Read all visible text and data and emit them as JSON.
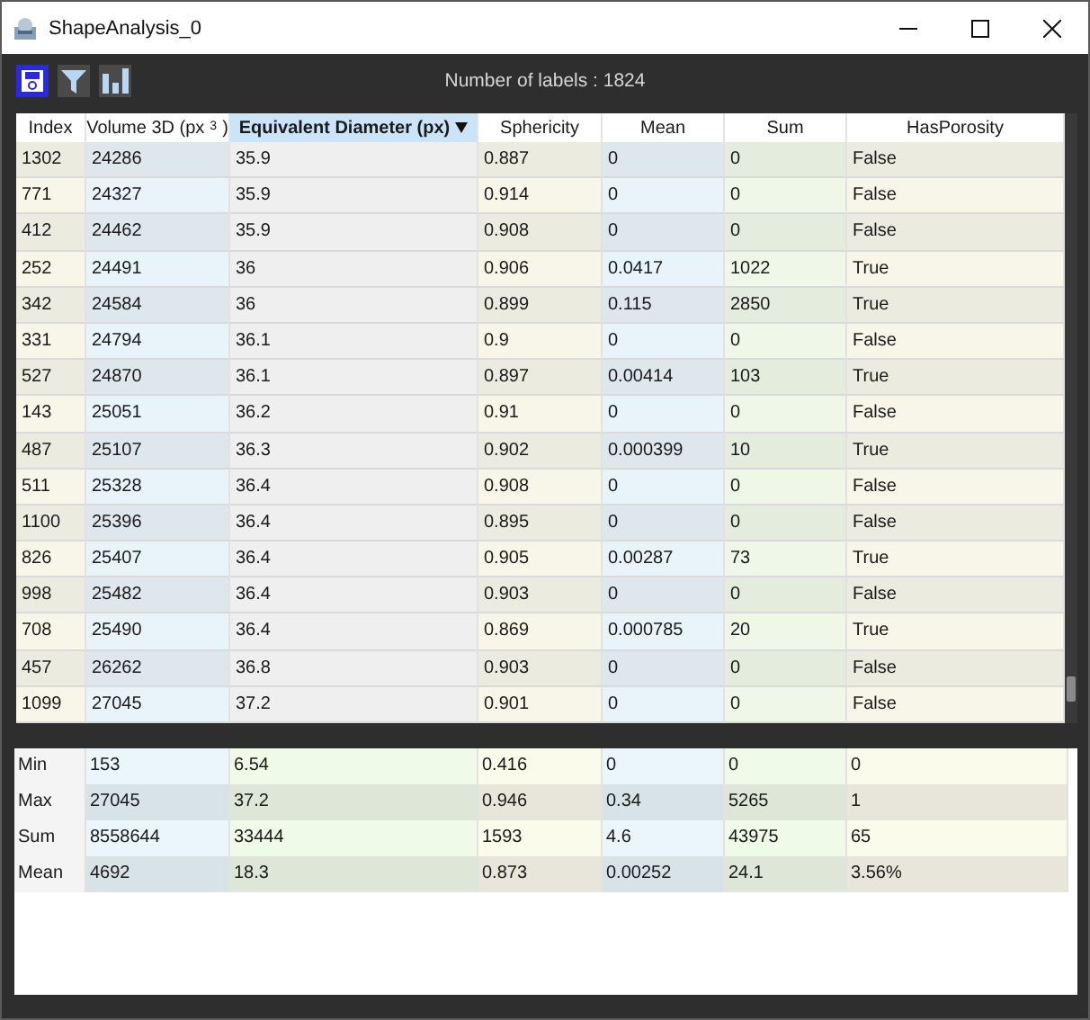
{
  "window": {
    "title": "ShapeAnalysis_0"
  },
  "label_count": "Number of labels : 1824",
  "table": {
    "columns": [
      {
        "label": "Index",
        "sorted": false
      },
      {
        "label": "Volume 3D (px$^{3}$)",
        "sorted": false
      },
      {
        "label": "Equivalent Diameter (px)",
        "sorted": true
      },
      {
        "label": "Sphericity",
        "sorted": false
      },
      {
        "label": "Mean",
        "sorted": false
      },
      {
        "label": "Sum",
        "sorted": false
      },
      {
        "label": "HasPorosity",
        "sorted": false
      }
    ],
    "rows": [
      [
        "1302",
        "24286",
        "35.9",
        "0.887",
        "0",
        "0",
        "False"
      ],
      [
        "771",
        "24327",
        "35.9",
        "0.914",
        "0",
        "0",
        "False"
      ],
      [
        "412",
        "24462",
        "35.9",
        "0.908",
        "0",
        "0",
        "False"
      ],
      [
        "252",
        "24491",
        "36",
        "0.906",
        "0.0417",
        "1022",
        "True"
      ],
      [
        "342",
        "24584",
        "36",
        "0.899",
        "0.115",
        "2850",
        "True"
      ],
      [
        "331",
        "24794",
        "36.1",
        "0.9",
        "0",
        "0",
        "False"
      ],
      [
        "527",
        "24870",
        "36.1",
        "0.897",
        "0.00414",
        "103",
        "True"
      ],
      [
        "143",
        "25051",
        "36.2",
        "0.91",
        "0",
        "0",
        "False"
      ],
      [
        "487",
        "25107",
        "36.3",
        "0.902",
        "0.000399",
        "10",
        "True"
      ],
      [
        "511",
        "25328",
        "36.4",
        "0.908",
        "0",
        "0",
        "False"
      ],
      [
        "1100",
        "25396",
        "36.4",
        "0.895",
        "0",
        "0",
        "False"
      ],
      [
        "826",
        "25407",
        "36.4",
        "0.905",
        "0.00287",
        "73",
        "True"
      ],
      [
        "998",
        "25482",
        "36.4",
        "0.903",
        "0",
        "0",
        "False"
      ],
      [
        "708",
        "25490",
        "36.4",
        "0.869",
        "0.000785",
        "20",
        "True"
      ],
      [
        "457",
        "26262",
        "36.8",
        "0.903",
        "0",
        "0",
        "False"
      ],
      [
        "1099",
        "27045",
        "37.2",
        "0.901",
        "0",
        "0",
        "False"
      ]
    ]
  },
  "summary": {
    "rows": [
      [
        "Min",
        "153",
        "6.54",
        "0.416",
        "0",
        "0",
        "0"
      ],
      [
        "Max",
        "27045",
        "37.2",
        "0.946",
        "0.34",
        "5265",
        "1"
      ],
      [
        "Sum",
        "8558644",
        "33444",
        "1593",
        "4.6",
        "43975",
        "65"
      ],
      [
        "Mean",
        "4692",
        "18.3",
        "0.873",
        "0.00252",
        "24.1",
        "3.56%"
      ]
    ]
  }
}
